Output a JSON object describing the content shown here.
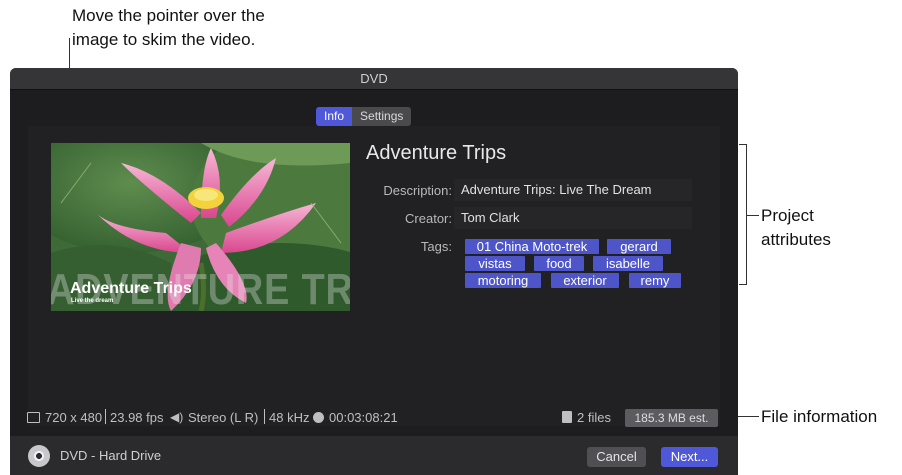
{
  "callouts": {
    "skim_line1": "Move the pointer over the",
    "skim_line2": "image to skim the video.",
    "attributes_line1": "Project",
    "attributes_line2": "attributes",
    "file_info": "File information"
  },
  "window": {
    "title": "DVD",
    "tabs": [
      {
        "label": "Info",
        "active": true
      },
      {
        "label": "Settings",
        "active": false
      }
    ]
  },
  "preview": {
    "watermark": "ADVENTURE TRIPS",
    "title": "Adventure Trips",
    "subtitle": "Live the dream"
  },
  "project": {
    "name": "Adventure Trips",
    "description_label": "Description:",
    "description": "Adventure Trips: Live The Dream",
    "creator_label": "Creator:",
    "creator": "Tom Clark",
    "tags_label": "Tags:",
    "tags": [
      "01 China Moto-trek",
      "gerard",
      "vistas",
      "food",
      "isabelle",
      "motoring",
      "exterior",
      "remy"
    ]
  },
  "file_info": {
    "resolution": "720 x 480",
    "frame_rate": "23.98 fps",
    "audio": "Stereo (L R)",
    "sample_rate": "48 kHz",
    "duration": "00:03:08:21",
    "file_count": "2 files",
    "estimate": "185.3 MB est."
  },
  "footer": {
    "destination": "DVD - Hard Drive",
    "cancel_label": "Cancel",
    "next_label": "Next..."
  },
  "colors": {
    "accent": "#4f58d8",
    "tag_bg": "#4e55c9",
    "window_bg": "#1d1d1f"
  }
}
